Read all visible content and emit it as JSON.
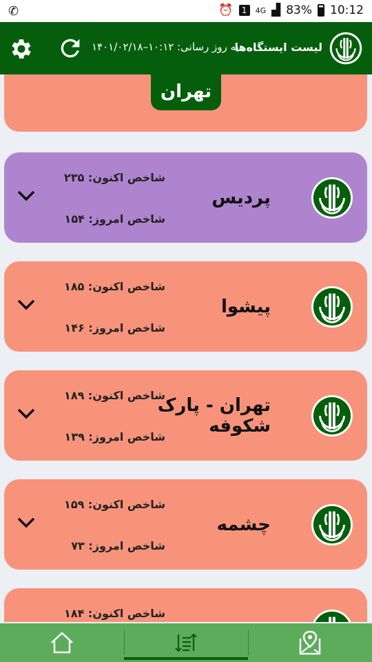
{
  "status_bar": {
    "battery": "83%",
    "time": "10:12",
    "network": "4G",
    "sim": "1"
  },
  "header": {
    "title": "لیست ایستگاه‌ها",
    "updated": "به روز رسانی: ۱۰:۱۲–۱۴۰۱/۰۲/۱۸"
  },
  "city": "تهران",
  "labels": {
    "now": "شاخص اکنون:",
    "today": "شاخص امروز:"
  },
  "stations": [
    {
      "name": "پردیس",
      "now": "۲۳۵",
      "today": "۱۵۴",
      "color": "#ae84cf"
    },
    {
      "name": "پیشوا",
      "now": "۱۸۵",
      "today": "۱۴۶",
      "color": "#f7937a"
    },
    {
      "name": "تهران - پارک شکوفه",
      "now": "۱۸۹",
      "today": "۱۳۹",
      "color": "#f7937a"
    },
    {
      "name": "چشمه",
      "now": "۱۵۹",
      "today": "۷۳",
      "color": "#f7937a"
    },
    {
      "name": "",
      "now": "۱۸۴",
      "today": "",
      "color": "#f7937a"
    }
  ],
  "colors": {
    "brand_green": "#055e0c",
    "nav_green": "#5cac5c",
    "unhealthy_sensitive": "#f7937a",
    "very_unhealthy": "#ae84cf"
  },
  "icons": {
    "settings": "gear-icon",
    "refresh": "refresh-icon",
    "home": "home-icon",
    "list": "sort-list-icon",
    "map": "map-pin-icon",
    "expand": "chevron-down-icon"
  }
}
